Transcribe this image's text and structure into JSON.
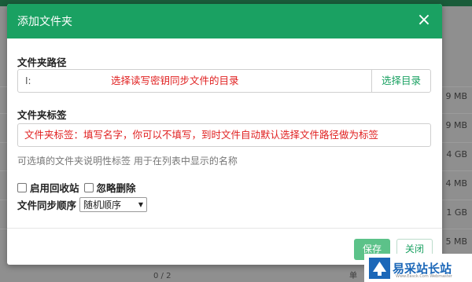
{
  "background": {
    "sizes": [
      "9 MB",
      "9 MB",
      "4 GB",
      "4 MB",
      "1 GB",
      "5 MB"
    ],
    "bottom_left": "0 / 2",
    "bottom_right": "单"
  },
  "modal": {
    "title": "添加文件夹",
    "close_symbol": "×",
    "path_label": "文件夹路径",
    "path_value": "I:",
    "path_hint": "选择读写密钥同步文件的目录",
    "browse_label": "选择目录",
    "tag_label": "文件夹标签",
    "tag_hint": "文件夹标签：填写名字，你可以不填写，到时文件自动默认选择文件路径做为标签",
    "help_text": "可选填的文件夹说明性标签 用于在列表中显示的名称",
    "recycle_label": "启用回收站",
    "ignore_delete_label": "忽略删除",
    "order_label": "文件同步顺序",
    "order_selected": "随机顺序",
    "save_label": "保存",
    "close_label": "关闭"
  },
  "watermark": {
    "text": "易采站长站",
    "subtext": "Www.Easck.Com  Webmaster"
  },
  "colors": {
    "header": "#1aa162",
    "hint_red": "#e02020",
    "save_button": "#5cc289",
    "watermark_blue": "#1b67b8"
  }
}
